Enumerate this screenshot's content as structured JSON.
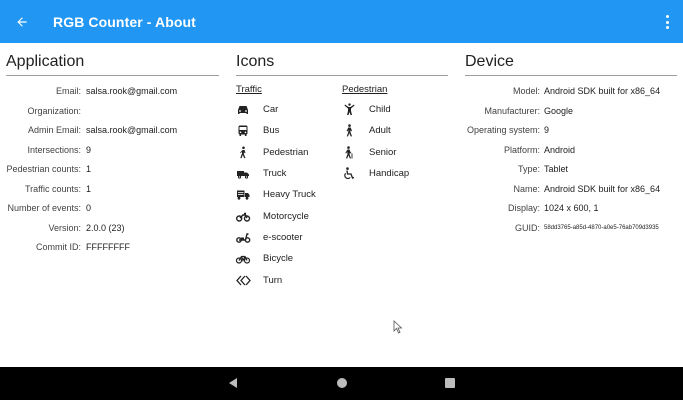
{
  "appbar": {
    "title": "RGB Counter - About",
    "back_icon": "arrow-left-icon",
    "menu_icon": "more-vert-icon"
  },
  "application": {
    "heading": "Application",
    "rows": [
      {
        "key": "Email:",
        "value": "salsa.rook@gmail.com"
      },
      {
        "key": "Organization:",
        "value": ""
      },
      {
        "key": "Admin Email:",
        "value": "salsa.rook@gmail.com"
      },
      {
        "key": "Intersections:",
        "value": "9"
      },
      {
        "key": "Pedestrian counts:",
        "value": "1"
      },
      {
        "key": "Traffic counts:",
        "value": "1"
      },
      {
        "key": "Number of events:",
        "value": "0"
      },
      {
        "key": "Version:",
        "value": "2.0.0 (23)"
      },
      {
        "key": "Commit ID:",
        "value": "FFFFFFFF"
      }
    ]
  },
  "icons": {
    "heading": "Icons",
    "traffic": {
      "heading": "Traffic",
      "items": [
        {
          "label": "Car",
          "icon": "car-icon"
        },
        {
          "label": "Bus",
          "icon": "bus-icon"
        },
        {
          "label": "Pedestrian",
          "icon": "pedestrian-icon"
        },
        {
          "label": "Truck",
          "icon": "truck-icon"
        },
        {
          "label": "Heavy Truck",
          "icon": "heavy-truck-icon"
        },
        {
          "label": "Motorcycle",
          "icon": "motorcycle-icon"
        },
        {
          "label": "e-scooter",
          "icon": "e-scooter-icon"
        },
        {
          "label": "Bicycle",
          "icon": "bicycle-icon"
        },
        {
          "label": "Turn",
          "icon": "turn-icon"
        }
      ]
    },
    "pedestrian": {
      "heading": "Pedestrian",
      "items": [
        {
          "label": "Child",
          "icon": "child-icon"
        },
        {
          "label": "Adult",
          "icon": "adult-icon"
        },
        {
          "label": "Senior",
          "icon": "senior-icon"
        },
        {
          "label": "Handicap",
          "icon": "handicap-icon"
        }
      ]
    }
  },
  "device": {
    "heading": "Device",
    "rows": [
      {
        "key": "Model:",
        "value": "Android SDK built for x86_64"
      },
      {
        "key": "Manufacturer:",
        "value": "Google"
      },
      {
        "key": "Operating system:",
        "value": "9"
      },
      {
        "key": "Platform:",
        "value": "Android"
      },
      {
        "key": "Type:",
        "value": "Tablet"
      },
      {
        "key": "Name:",
        "value": "Android SDK built for x86_64"
      },
      {
        "key": "Display:",
        "value": "1024 x 600, 1"
      },
      {
        "key": "GUID:",
        "value": "58dd3765-a85d-4870-a0e5-76ab709d3935"
      }
    ]
  },
  "navbar": {
    "back_icon": "nav-back-icon",
    "home_icon": "nav-home-icon",
    "recent_icon": "nav-recent-icon"
  },
  "colors": {
    "appbar": "#2196f3",
    "navbar": "#000000"
  }
}
